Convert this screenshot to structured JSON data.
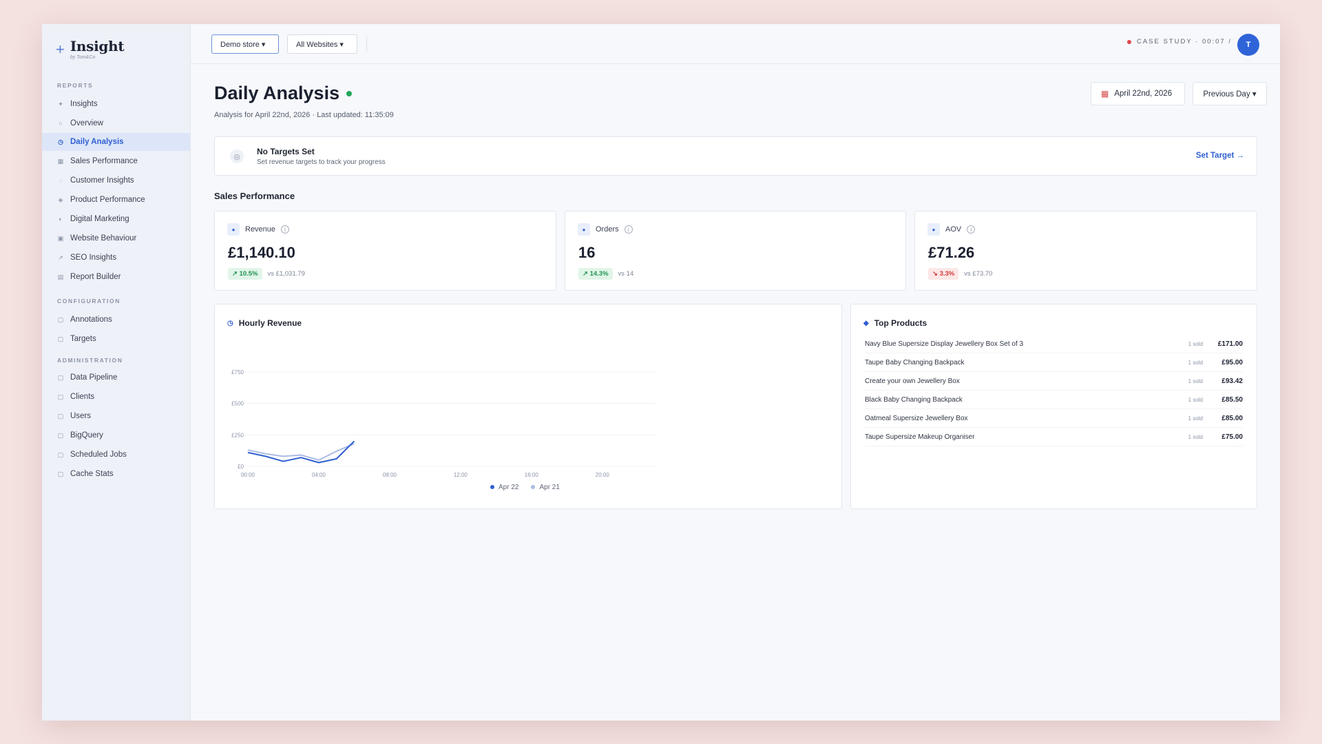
{
  "brand": {
    "name": "Insight",
    "tagline": "by Tom&Co"
  },
  "sidebar": {
    "sections": [
      {
        "label": "REPORTS"
      },
      {
        "label": "CONFIGURATION"
      },
      {
        "label": "ADMINISTRATION"
      }
    ],
    "items": [
      {
        "label": "Insights",
        "icon": "sparkle-icon"
      },
      {
        "label": "Overview",
        "icon": "circle-icon"
      },
      {
        "label": "Daily Analysis",
        "icon": "calendar-icon",
        "active": true
      },
      {
        "label": "Sales Performance",
        "icon": "grid-icon"
      },
      {
        "label": "Customer Insights",
        "icon": "user-icon"
      },
      {
        "label": "Product Performance",
        "icon": "box-icon"
      },
      {
        "label": "Digital Marketing",
        "icon": "megaphone-icon"
      },
      {
        "label": "Website Behaviour",
        "icon": "globe-icon"
      },
      {
        "label": "SEO Insights",
        "icon": "search-icon"
      },
      {
        "label": "Report Builder",
        "icon": "table-icon"
      },
      {
        "label": "Annotations",
        "icon": "note-icon"
      },
      {
        "label": "Targets",
        "icon": "target-icon"
      },
      {
        "label": "Data Pipeline",
        "icon": "pipeline-icon"
      },
      {
        "label": "Clients",
        "icon": "users-icon"
      },
      {
        "label": "Users",
        "icon": "user-icon"
      },
      {
        "label": "BigQuery",
        "icon": "database-icon"
      },
      {
        "label": "Scheduled Jobs",
        "icon": "clock-icon"
      },
      {
        "label": "Cache Stats",
        "icon": "chart-icon"
      }
    ]
  },
  "topbar": {
    "store_dropdown": "Demo store ▾",
    "website_dropdown": "All Websites ▾",
    "case_study": "CASE STUDY · 00:07 /",
    "avatar_initial": "T"
  },
  "header": {
    "title": "Daily Analysis",
    "subtitle": "Analysis for April 22nd, 2026 · Last updated: 11:35:09",
    "date_button": "April 22nd, 2026",
    "compare_button": "Previous Day ▾"
  },
  "targets_banner": {
    "title": "No Targets Set",
    "subtitle": "Set revenue targets to track your progress",
    "link": "Set Target →"
  },
  "sales_performance": {
    "title": "Sales Performance",
    "kpis": [
      {
        "label": "Revenue",
        "value": "£1,140.10",
        "change": "↗ 10.5%",
        "direction": "up",
        "compare": "vs £1,031.79"
      },
      {
        "label": "Orders",
        "value": "16",
        "change": "↗ 14.3%",
        "direction": "up",
        "compare": "vs 14"
      },
      {
        "label": "AOV",
        "value": "£71.26",
        "change": "↘ 3.3%",
        "direction": "down",
        "compare": "vs £73.70"
      }
    ]
  },
  "hourly_revenue": {
    "title": "Hourly Revenue"
  },
  "chart_data": {
    "type": "line",
    "title": "Hourly Revenue",
    "x": [
      "00:00",
      "01:00",
      "02:00",
      "03:00",
      "04:00",
      "05:00",
      "06:00"
    ],
    "xticks": [
      "00:00",
      "04:00",
      "08:00",
      "12:00",
      "16:00",
      "20:00"
    ],
    "xlim": [
      0,
      23
    ],
    "yticks": [
      "£0",
      "£250",
      "£500",
      "£750"
    ],
    "ylim": [
      0,
      1000
    ],
    "series": [
      {
        "name": "Apr 22",
        "color": "#2f5fd0",
        "values": [
          110,
          80,
          40,
          70,
          30,
          60,
          200
        ]
      },
      {
        "name": "Apr 21",
        "color": "#a9bbe4",
        "values": [
          130,
          100,
          80,
          90,
          50,
          120,
          180
        ]
      }
    ],
    "legend_position": "bottom",
    "grid": true
  },
  "top_products": {
    "title": "Top Products",
    "items": [
      {
        "name": "Navy Blue Supersize Display Jewellery Box Set of 3",
        "sold": "1 sold",
        "price": "£171.00"
      },
      {
        "name": "Taupe Baby Changing Backpack",
        "sold": "1 sold",
        "price": "£95.00"
      },
      {
        "name": "Create your own Jewellery Box",
        "sold": "1 sold",
        "price": "£93.42"
      },
      {
        "name": "Black Baby Changing Backpack",
        "sold": "1 sold",
        "price": "£85.50"
      },
      {
        "name": "Oatmeal Supersize Jewellery Box",
        "sold": "1 sold",
        "price": "£85.00"
      },
      {
        "name": "Taupe Supersize Makeup Organiser",
        "sold": "1 sold",
        "price": "£75.00"
      }
    ]
  }
}
